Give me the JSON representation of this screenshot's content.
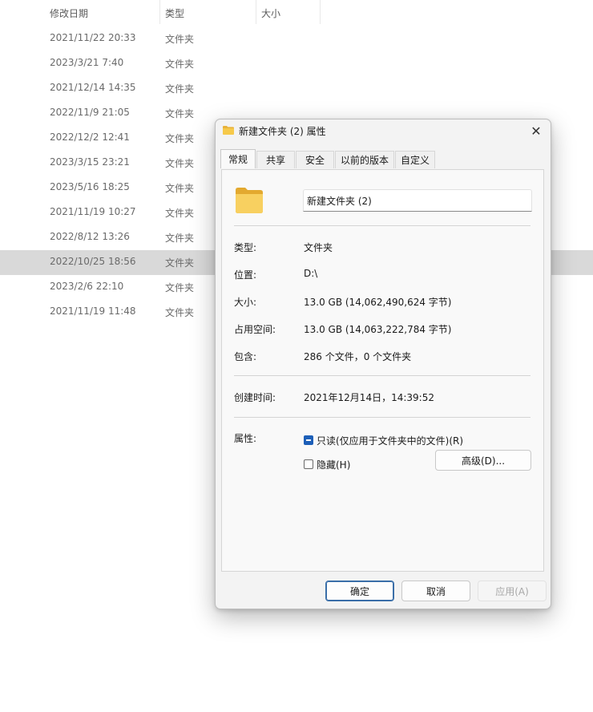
{
  "explorer": {
    "columns": [
      "修改日期",
      "类型",
      "大小"
    ],
    "rows": [
      {
        "date": "2021/11/22 20:33",
        "type": "文件夹"
      },
      {
        "date": "2023/3/21 7:40",
        "type": "文件夹"
      },
      {
        "date": "2021/12/14 14:35",
        "type": "文件夹"
      },
      {
        "date": "2022/11/9 21:05",
        "type": "文件夹"
      },
      {
        "date": "2022/12/2 12:41",
        "type": "文件夹"
      },
      {
        "date": "2023/3/15 23:21",
        "type": "文件夹"
      },
      {
        "date": "2023/5/16 18:25",
        "type": "文件夹"
      },
      {
        "date": "2021/11/19 10:27",
        "type": "文件夹"
      },
      {
        "date": "2022/8/12 13:26",
        "type": "文件夹"
      },
      {
        "date": "2022/10/25 18:56",
        "type": "文件夹"
      },
      {
        "date": "2023/2/6 22:10",
        "type": "文件夹"
      },
      {
        "date": "2021/11/19 11:48",
        "type": "文件夹"
      }
    ],
    "selected_row": 9
  },
  "dialog": {
    "title": "新建文件夹 (2) 属性",
    "close_icon": "close-icon",
    "tabs": [
      "常规",
      "共享",
      "安全",
      "以前的版本",
      "自定义"
    ],
    "active_tab": 0,
    "folder_name": "新建文件夹 (2)",
    "props": {
      "type_label": "类型:",
      "type_value": "文件夹",
      "location_label": "位置:",
      "location_value": "D:\\",
      "size_label": "大小:",
      "size_value": "13.0 GB (14,062,490,624 字节)",
      "disk_label": "占用空间:",
      "disk_value": "13.0 GB (14,063,222,784 字节)",
      "contains_label": "包含:",
      "contains_value": "286 个文件，0 个文件夹",
      "created_label": "创建时间:",
      "created_value": "2021年12月14日，14:39:52",
      "attr_label": "属性:"
    },
    "attributes": {
      "readonly_label": "只读(仅应用于文件夹中的文件)(R)",
      "hidden_label": "隐藏(H)",
      "advanced_label": "高级(D)..."
    },
    "buttons": {
      "ok": "确定",
      "cancel": "取消",
      "apply": "应用(A)"
    },
    "colors": {
      "folder": "#f6c94a",
      "checkbox_accent": "#1d5fb8"
    }
  }
}
